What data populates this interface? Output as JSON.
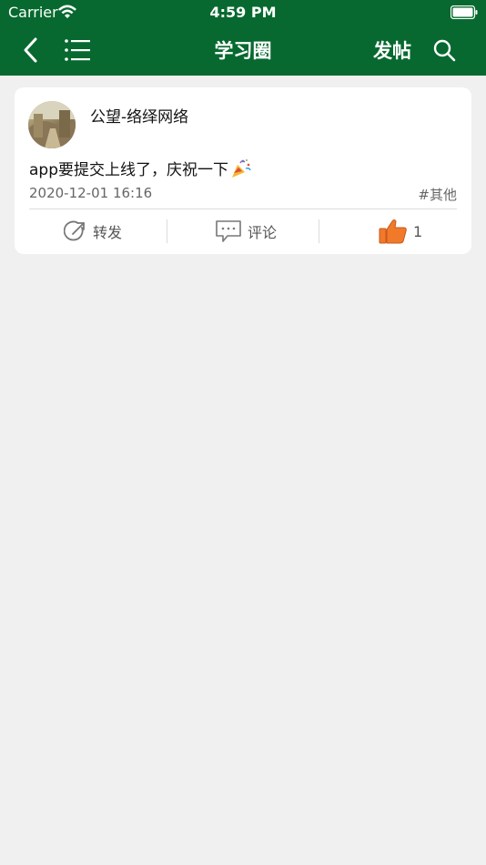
{
  "status_bar": {
    "carrier": "Carrier",
    "time": "4:59 PM"
  },
  "nav": {
    "title": "学习圈",
    "post_label": "发帖",
    "color": "#07692f"
  },
  "post": {
    "author": "公望-络绎网络",
    "content": "app要提交上线了，庆祝一下",
    "timestamp": "2020-12-01 16:16",
    "tag": "#其他",
    "actions": {
      "forward_label": "转发",
      "comment_label": "评论",
      "like_count": "1"
    },
    "like_color": "#f07a2a"
  }
}
